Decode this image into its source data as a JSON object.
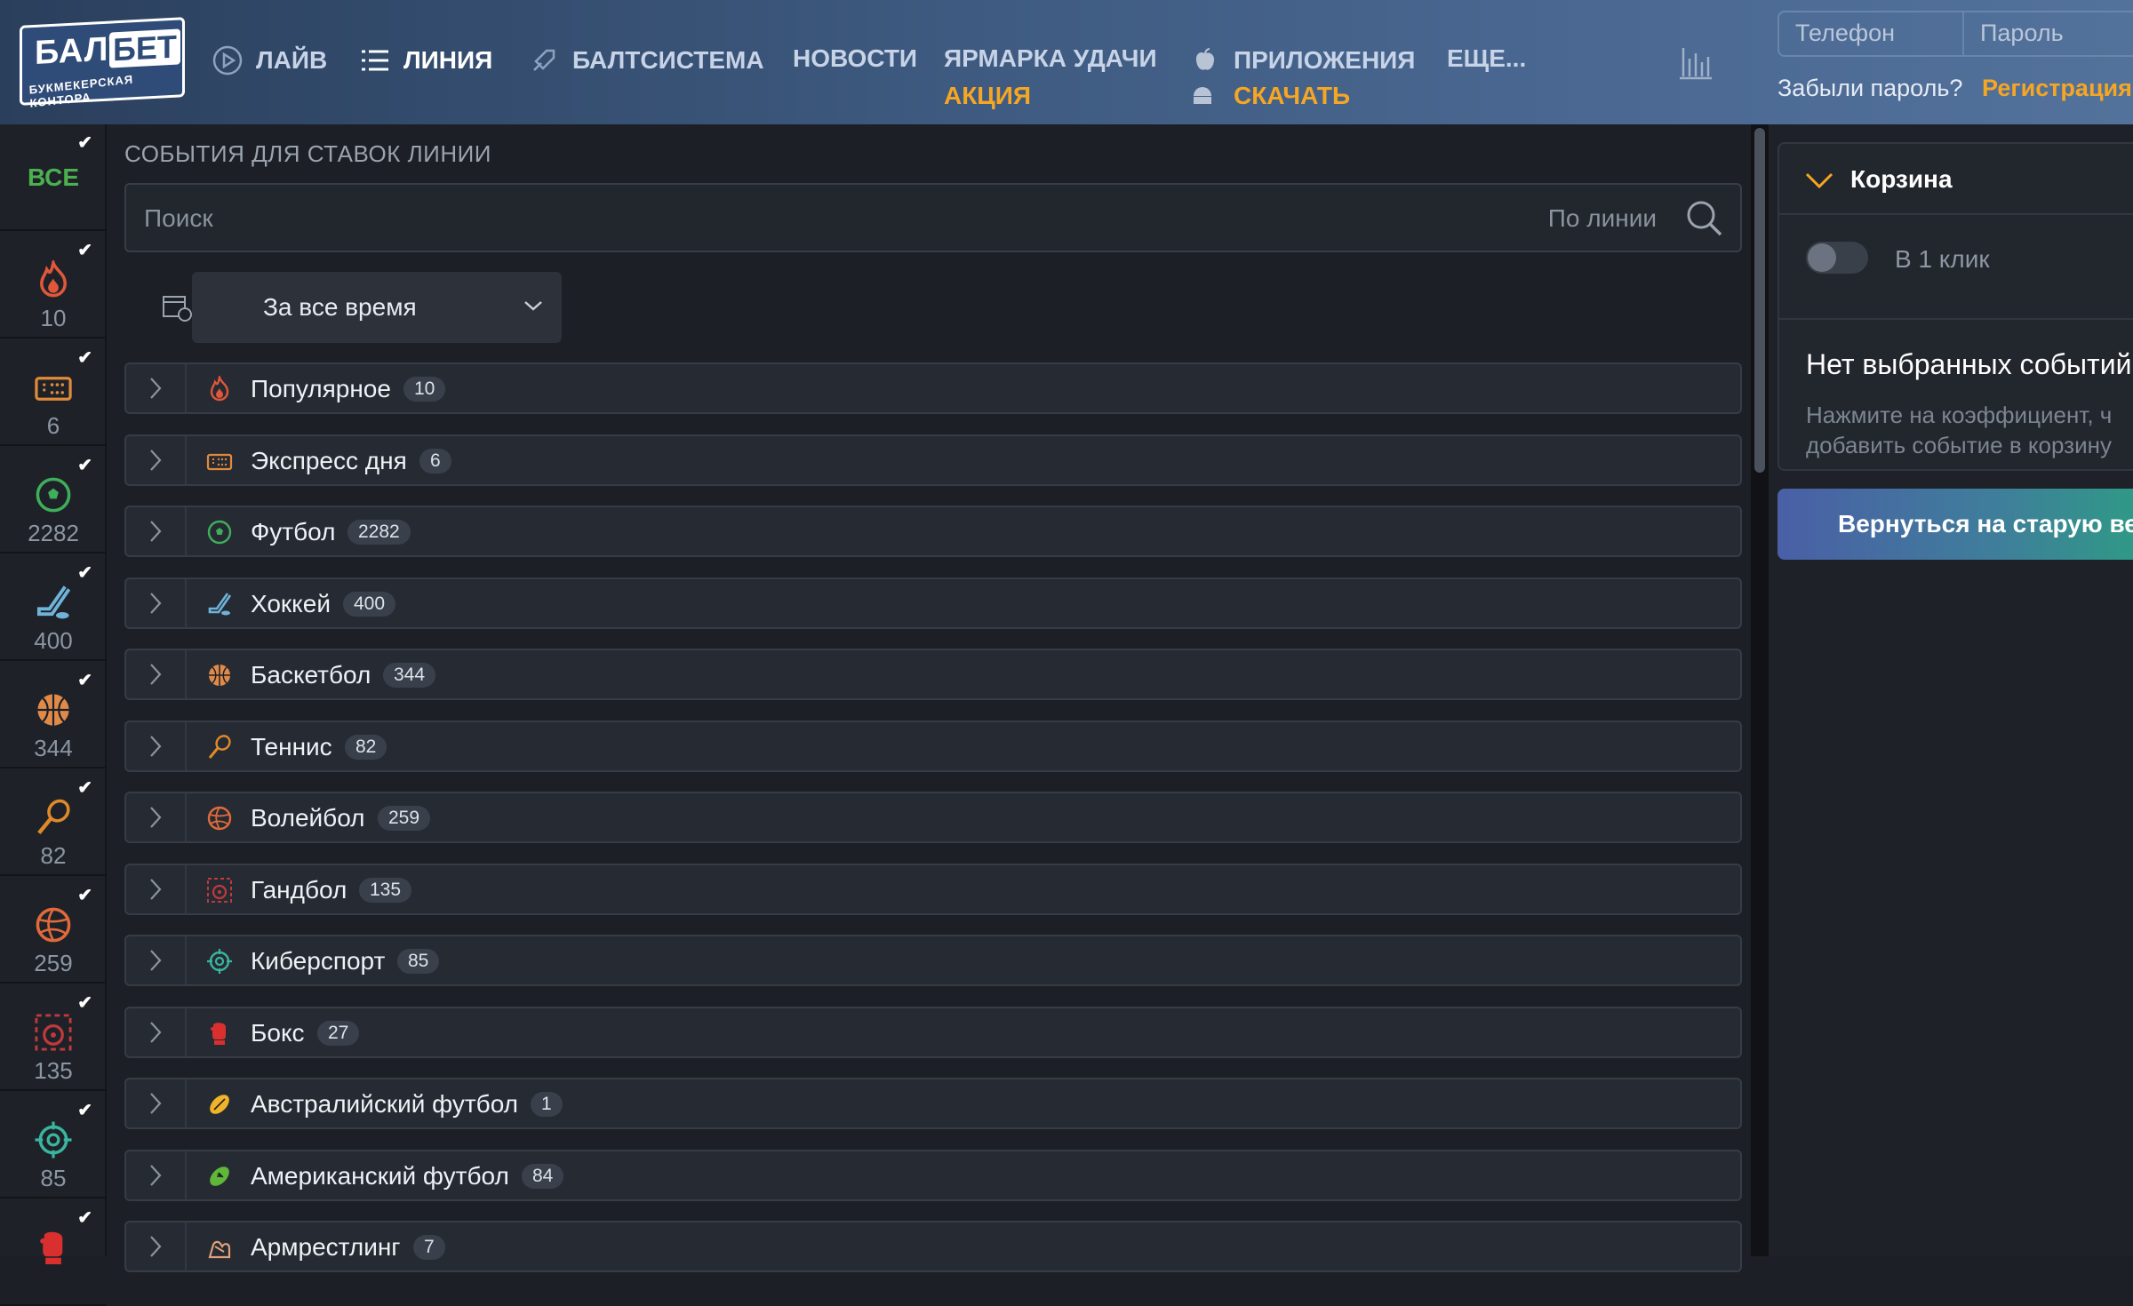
{
  "header": {
    "logo": {
      "text_main": "БАЛТ",
      "text_bet": "БЕТ",
      "text_sub": "БУКМЕКЕРСКАЯ КОНТОРА"
    },
    "nav": [
      {
        "label": "ЛАЙВ",
        "icon": "play-icon"
      },
      {
        "label": "ЛИНИЯ",
        "icon": "list-icon",
        "active": true
      },
      {
        "label": "БАЛТСИСТЕМА",
        "icon": "rocket-icon"
      },
      {
        "label": "НОВОСТИ"
      },
      {
        "label": "ЯРМАРКА УДАЧИ",
        "sub": "АКЦИЯ"
      },
      {
        "label": "ПРИЛОЖЕНИЯ",
        "sub": "СКАЧАТЬ",
        "icon": "apple-android-icon"
      },
      {
        "label": "ЕЩЕ..."
      }
    ],
    "login": {
      "phone_placeholder": "Телефон",
      "password_placeholder": "Пароль",
      "forgot": "Забыли пароль?",
      "register": "Регистрация"
    }
  },
  "sidebar": {
    "all_label": "ВСЕ",
    "items": [
      {
        "count": "10",
        "icon": "fire-icon",
        "color": "#e0573a"
      },
      {
        "count": "6",
        "icon": "ticket-icon",
        "color": "#e08a3a"
      },
      {
        "count": "2282",
        "icon": "football-icon",
        "color": "#3fae5b"
      },
      {
        "count": "400",
        "icon": "hockey-icon",
        "color": "#6fb3d8"
      },
      {
        "count": "344",
        "icon": "basketball-icon",
        "color": "#e08a4a"
      },
      {
        "count": "82",
        "icon": "tennis-icon",
        "color": "#e0892a"
      },
      {
        "count": "259",
        "icon": "volleyball-icon",
        "color": "#e06a3a"
      },
      {
        "count": "135",
        "icon": "handball-icon",
        "color": "#c0393b"
      },
      {
        "count": "85",
        "icon": "esports-icon",
        "color": "#3ab5a0"
      },
      {
        "count": "",
        "icon": "boxing-icon",
        "color": "#d9302f"
      }
    ]
  },
  "main": {
    "title": "СОБЫТИЯ ДЛЯ СТАВОК ЛИНИИ",
    "search_placeholder": "Поиск",
    "search_scope": "По линии",
    "period": "За все время",
    "categories": [
      {
        "label": "Популярное",
        "count": "10",
        "icon": "fire-icon",
        "color": "#e0573a"
      },
      {
        "label": "Экспресс дня",
        "count": "6",
        "icon": "ticket-icon",
        "color": "#e08a3a"
      },
      {
        "label": "Футбол",
        "count": "2282",
        "icon": "football-icon",
        "color": "#3fae5b"
      },
      {
        "label": "Хоккей",
        "count": "400",
        "icon": "hockey-icon",
        "color": "#6fb3d8"
      },
      {
        "label": "Баскетбол",
        "count": "344",
        "icon": "basketball-icon",
        "color": "#e08a4a"
      },
      {
        "label": "Теннис",
        "count": "82",
        "icon": "tennis-icon",
        "color": "#e0892a"
      },
      {
        "label": "Волейбол",
        "count": "259",
        "icon": "volleyball-icon",
        "color": "#e06a3a"
      },
      {
        "label": "Гандбол",
        "count": "135",
        "icon": "handball-icon",
        "color": "#c0393b"
      },
      {
        "label": "Киберспорт",
        "count": "85",
        "icon": "esports-icon",
        "color": "#3ab5a0"
      },
      {
        "label": "Бокс",
        "count": "27",
        "icon": "boxing-icon",
        "color": "#d9302f"
      },
      {
        "label": "Австралийский футбол",
        "count": "1",
        "icon": "aussie-football-icon",
        "color": "#f0b429"
      },
      {
        "label": "Американский футбол",
        "count": "84",
        "icon": "american-football-icon",
        "color": "#5fb83a"
      },
      {
        "label": "Армрестлинг",
        "count": "7",
        "icon": "armwrestling-icon",
        "color": "#e0a07a"
      }
    ]
  },
  "cart": {
    "title": "Корзина",
    "one_click": "В 1 клик",
    "empty_title": "Нет выбранных событий",
    "empty_hint": "Нажмите на коэффициент, ч добавить событие в корзину",
    "old_version": "Вернуться на старую вер"
  },
  "colors": {
    "accent": "#f5a623",
    "all_green": "#4cb050"
  }
}
